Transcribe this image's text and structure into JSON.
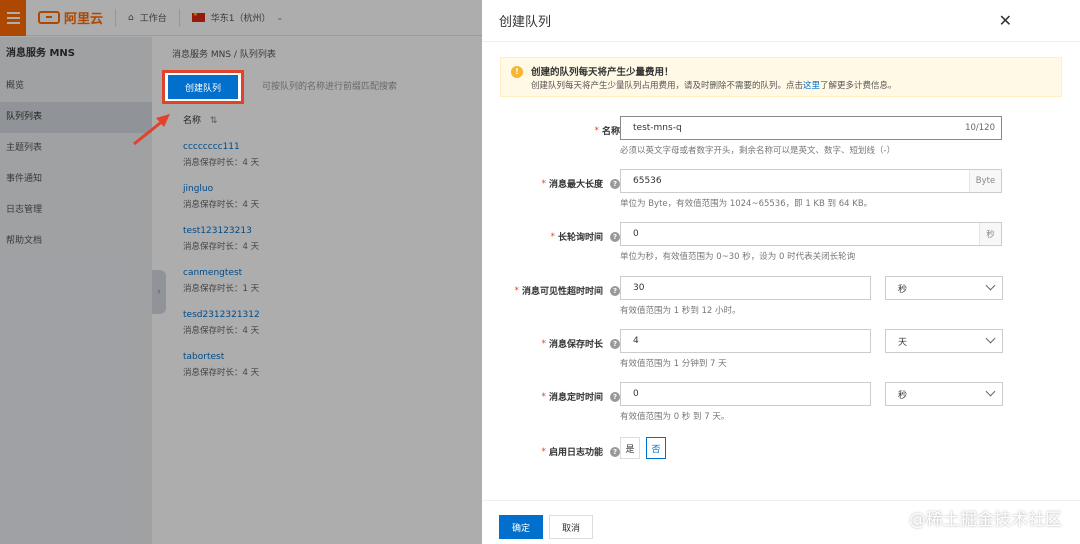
{
  "topbar": {
    "brand": "阿里云",
    "workbench": "工作台",
    "region": "华东1（杭州）"
  },
  "sidebar": {
    "title": "消息服务 MNS",
    "items": [
      {
        "label": "概览"
      },
      {
        "label": "队列列表"
      },
      {
        "label": "主题列表"
      },
      {
        "label": "事件通知"
      },
      {
        "label": "日志管理"
      },
      {
        "label": "帮助文档"
      }
    ]
  },
  "content": {
    "breadcrumb": "消息服务 MNS  /  队列列表",
    "create_button": "创建队列",
    "search_placeholder": "可按队列的名称进行前缀匹配搜索",
    "column_name": "名称",
    "queues": [
      {
        "name": "cccccccc111",
        "retention": "消息保存时长：4 天"
      },
      {
        "name": "jingluo",
        "retention": "消息保存时长：4 天"
      },
      {
        "name": "test123123213",
        "retention": "消息保存时长：4 天"
      },
      {
        "name": "canmengtest",
        "retention": "消息保存时长：1 天"
      },
      {
        "name": "tesd2312321312",
        "retention": "消息保存时长：4 天"
      },
      {
        "name": "tabortest",
        "retention": "消息保存时长：4 天"
      }
    ]
  },
  "drawer": {
    "title": "创建队列",
    "notice_title": "创建的队列每天将产生少量费用！",
    "notice_desc_pre": "创建队列每天将产生少量队列占用费用，请及时删除不需要的队列。点击",
    "notice_link": "这里",
    "notice_desc_post": "了解更多计费信息。",
    "fields": {
      "name": {
        "label": "名称",
        "value": "test-mns-q",
        "counter": "10/120",
        "hint": "必须以英文字母或者数字开头，剩余名称可以是英文、数字、短划线（-）"
      },
      "max_length": {
        "label": "消息最大长度",
        "value": "65536",
        "suffix": "Byte",
        "hint": "单位为 Byte，有效值范围为 1024~65536，即 1 KB 到 64 KB。"
      },
      "polling": {
        "label": "长轮询时间",
        "value": "0",
        "suffix": "秒",
        "hint": "单位为秒，有效值范围为 0~30 秒，设为 0 时代表关闭长轮询"
      },
      "visibility": {
        "label": "消息可见性超时时间",
        "value": "30",
        "unit": "秒",
        "hint": "有效值范围为 1 秒到 12 小时。"
      },
      "retention": {
        "label": "消息保存时长",
        "value": "4",
        "unit": "天",
        "hint": "有效值范围为 1 分钟到 7 天"
      },
      "delay": {
        "label": "消息定时时间",
        "value": "0",
        "unit": "秒",
        "hint": "有效值范围为 0 秒 到 7 天。"
      },
      "logging": {
        "label": "启用日志功能",
        "yes": "是",
        "no": "否",
        "selected": "否"
      }
    },
    "ok_label": "确定",
    "cancel_label": "取消"
  },
  "watermark": "@稀土掘金技术社区",
  "colors": {
    "accent": "#0070cc",
    "brand": "#ff6a00",
    "highlight": "#e0432c",
    "notice_bg": "#fff9e6"
  }
}
